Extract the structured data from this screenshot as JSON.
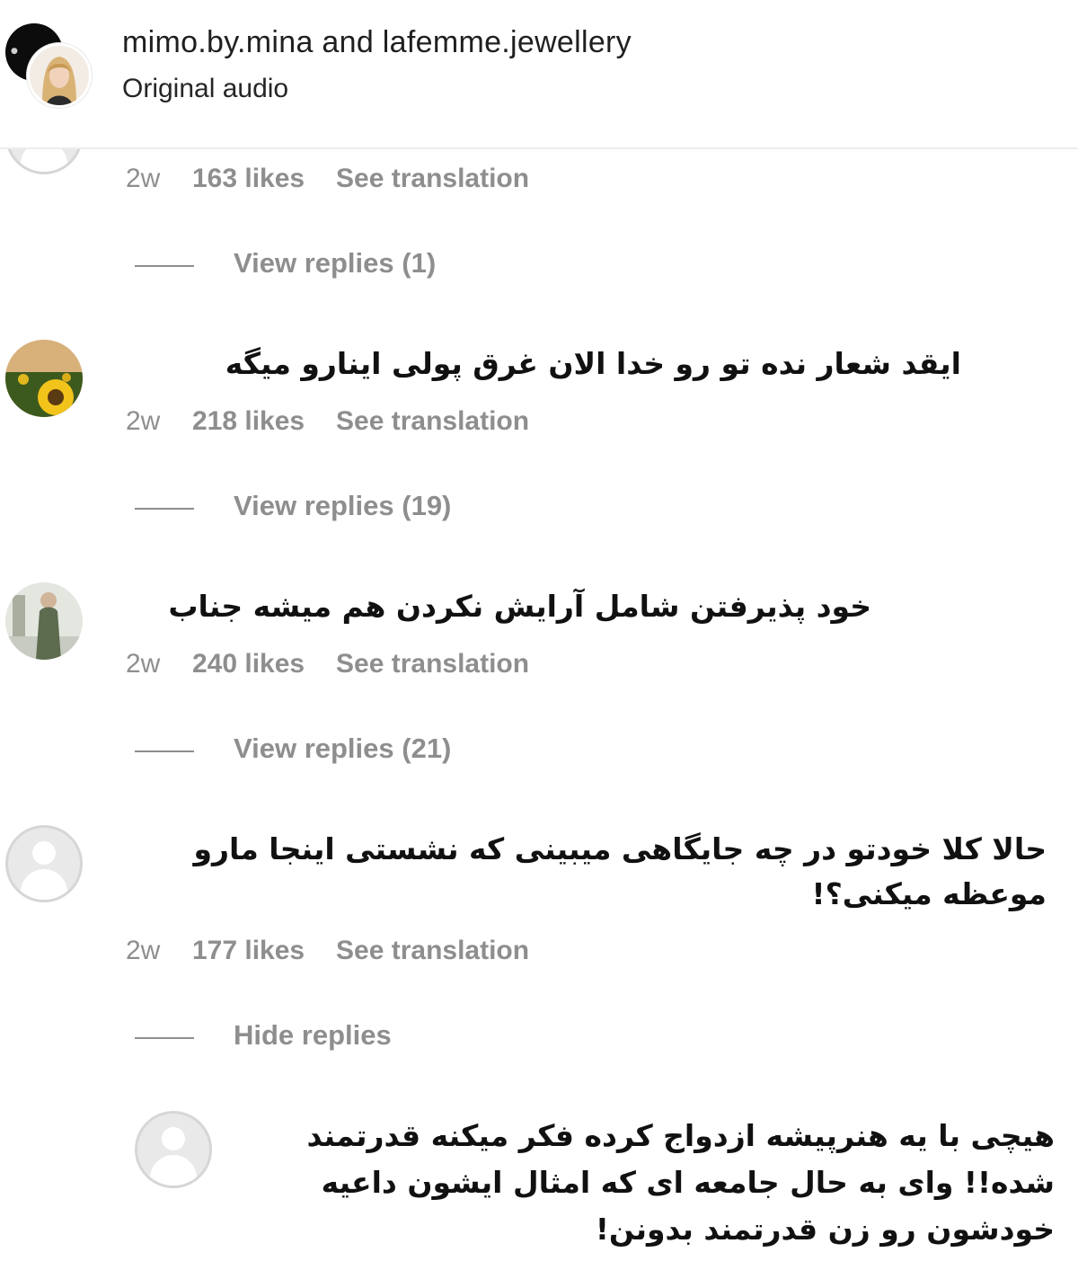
{
  "header": {
    "title": "mimo.by.mina and lafemme.jewellery",
    "subtitle": "Original audio"
  },
  "comments": [
    {
      "text": "",
      "time": "2w",
      "likes": "163 likes",
      "translate_label": "See translation",
      "replies_label": "View replies (1)"
    },
    {
      "text": "ایقد شعار نده تو رو خدا الان غرق پولی اینارو میگه",
      "time": "2w",
      "likes": "218 likes",
      "translate_label": "See translation",
      "replies_label": "View replies (19)"
    },
    {
      "text": "خود پذیرفتن شامل آرایش نکردن هم میشه جناب",
      "time": "2w",
      "likes": "240 likes",
      "translate_label": "See translation",
      "replies_label": "View replies (21)"
    },
    {
      "text": "حالا کلا خودتو در چه جایگاهی میبینی که نشستی اینجا مارو موعظه میکنی؟!",
      "time": "2w",
      "likes": "177 likes",
      "translate_label": "See translation",
      "replies_label": "Hide replies"
    }
  ],
  "reply": {
    "text": "هیچی با یه هنرپیشه ازدواج کرده فکر میکنه قدرتمند شده!! وای به حال جامعه ای که امثال ایشون داعیه خودشون رو زن قدرتمند بدونن!"
  },
  "colors": {
    "meta_gray": "#8e8e8e",
    "text_dark": "#111111",
    "divider": "#ededed"
  }
}
